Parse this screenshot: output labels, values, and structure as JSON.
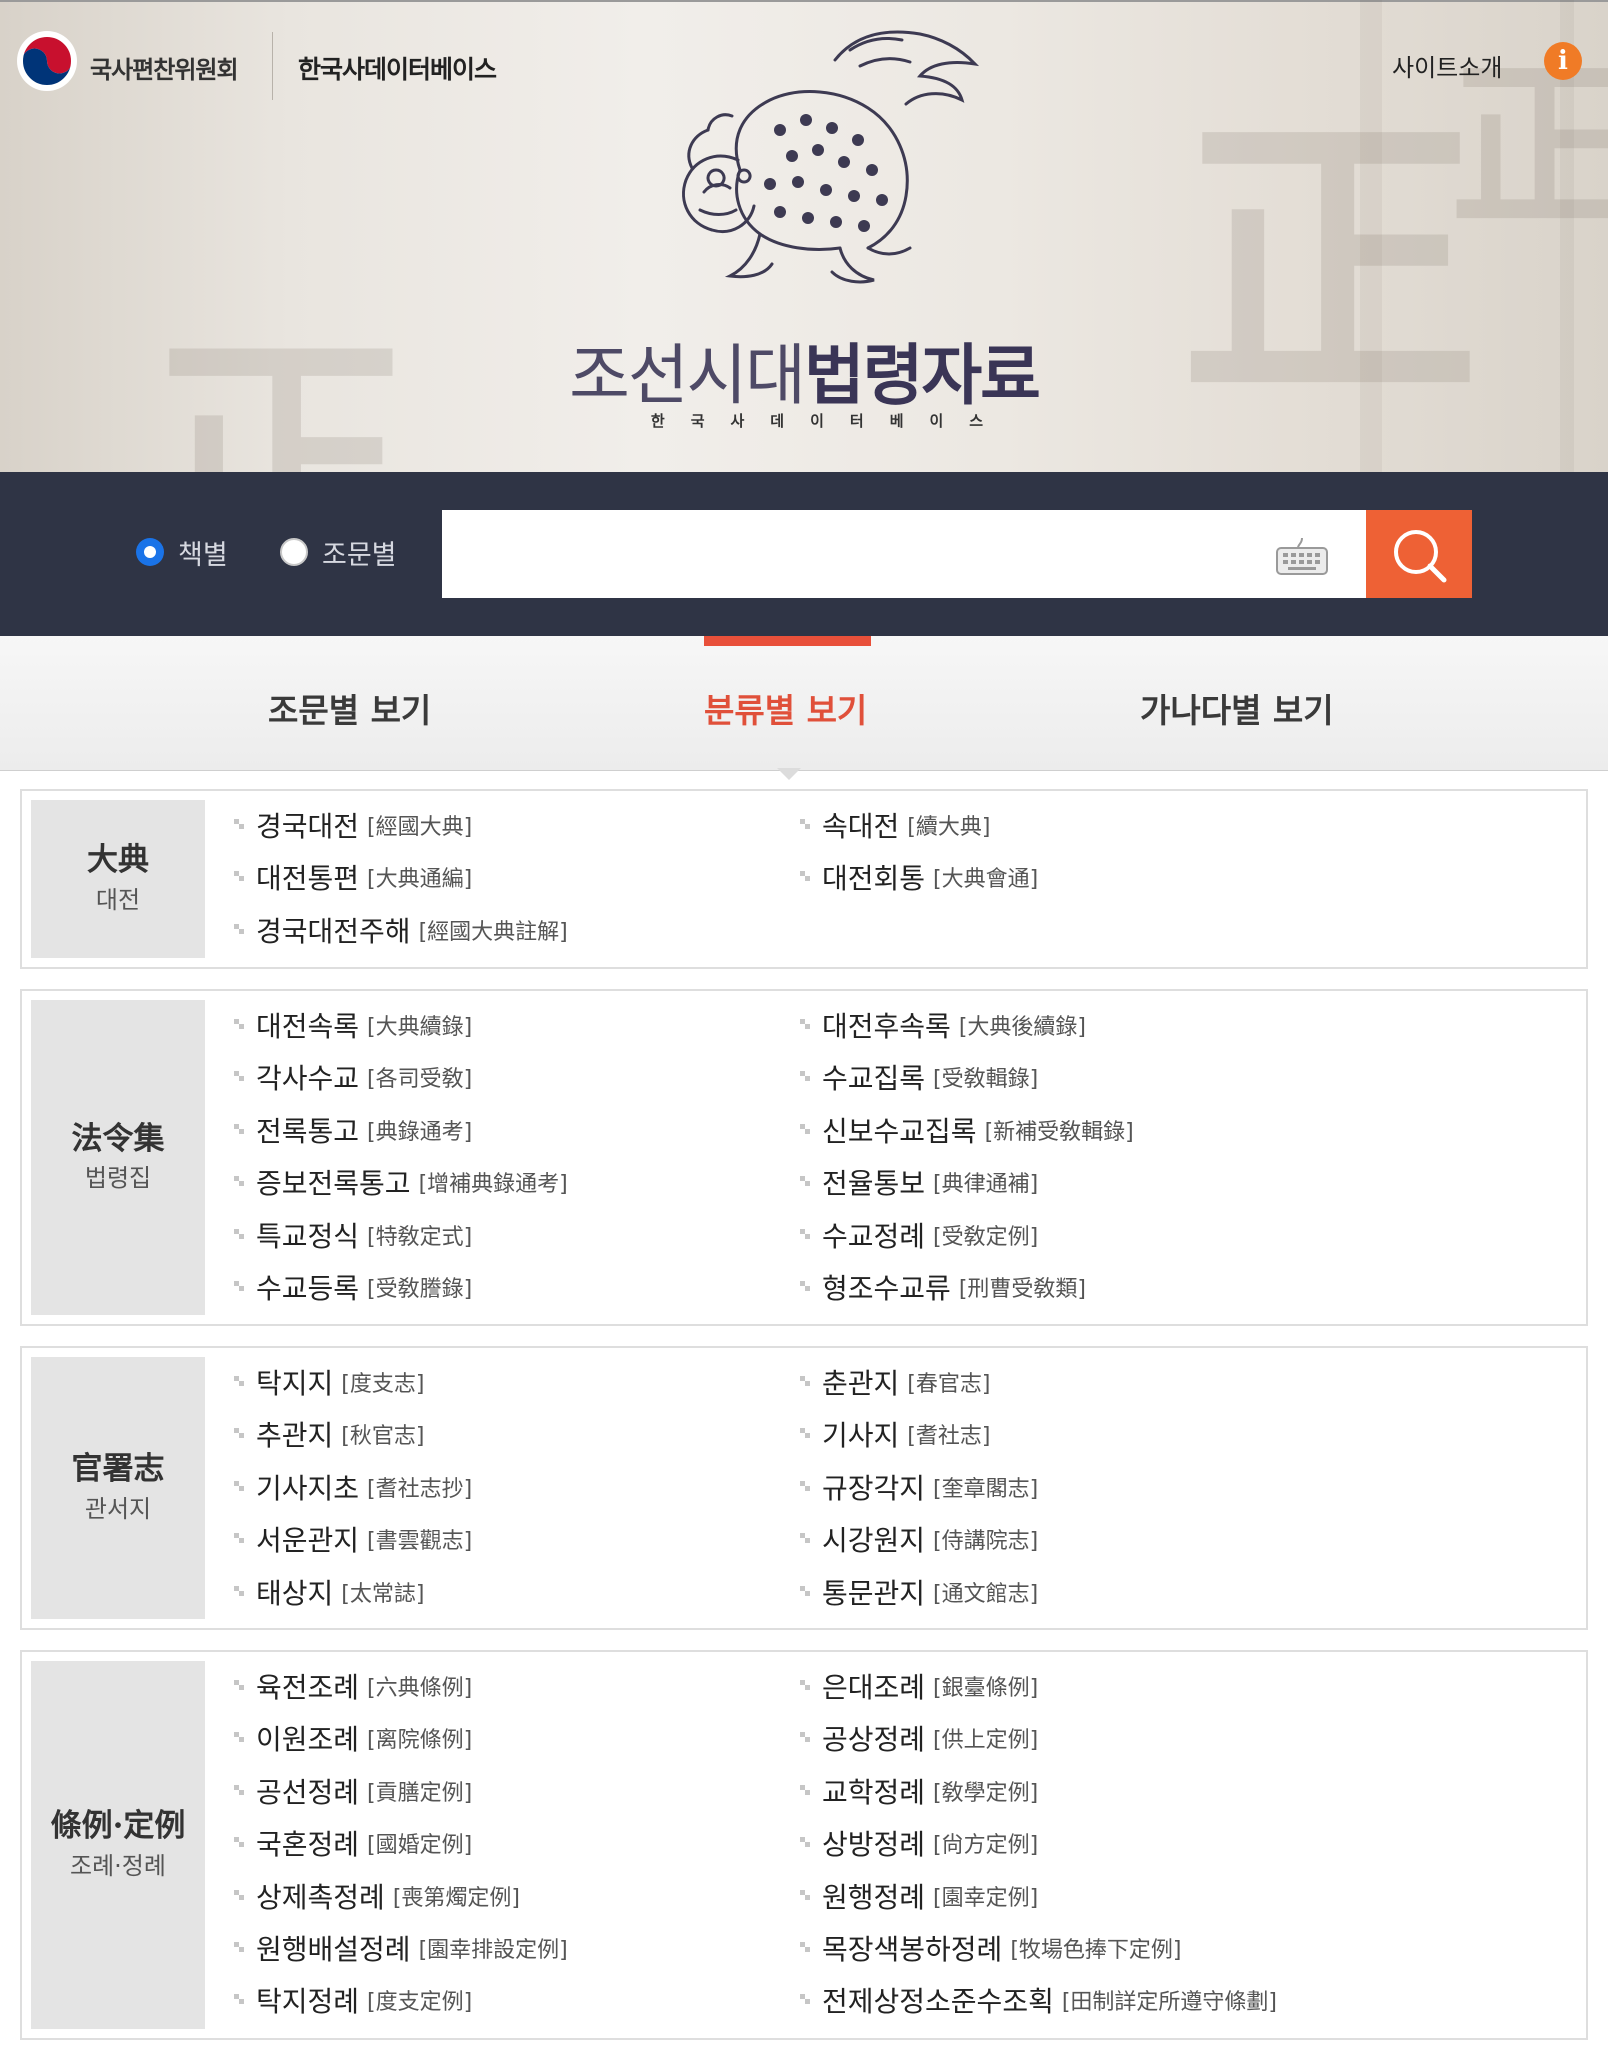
{
  "header": {
    "org_name": "국사편찬위원회",
    "db_name": "한국사데이터베이스",
    "site_intro": "사이트소개",
    "info_icon": "i",
    "title_light": "조선시대",
    "title_bold": "법령자료",
    "subtitle": "한국사데이터베이스"
  },
  "search": {
    "options": [
      {
        "label": "책별",
        "checked": true
      },
      {
        "label": "조문별",
        "checked": false
      }
    ],
    "placeholder": "",
    "accent_color": "#ee6135"
  },
  "tabs": [
    {
      "label": "조문별 보기",
      "active": false
    },
    {
      "label": "분류별 보기",
      "active": true
    },
    {
      "label": "가나다별 보기",
      "active": false
    }
  ],
  "sections": [
    {
      "hanja": "大典",
      "hangul": "대전",
      "items": [
        {
          "name": "경국대전",
          "hanja": "[經國大典]"
        },
        {
          "name": "속대전",
          "hanja": "[續大典]"
        },
        {
          "name": "대전통편",
          "hanja": "[大典通編]"
        },
        {
          "name": "대전회통",
          "hanja": "[大典會通]"
        },
        {
          "name": "경국대전주해",
          "hanja": "[經國大典註解]"
        }
      ]
    },
    {
      "hanja": "法令集",
      "hangul": "법령집",
      "items": [
        {
          "name": "대전속록",
          "hanja": "[大典續錄]"
        },
        {
          "name": "대전후속록",
          "hanja": "[大典後續錄]"
        },
        {
          "name": "각사수교",
          "hanja": "[各司受敎]"
        },
        {
          "name": "수교집록",
          "hanja": "[受敎輯錄]"
        },
        {
          "name": "전록통고",
          "hanja": "[典錄通考]"
        },
        {
          "name": "신보수교집록",
          "hanja": "[新補受敎輯錄]"
        },
        {
          "name": "증보전록통고",
          "hanja": "[增補典錄通考]"
        },
        {
          "name": "전율통보",
          "hanja": "[典律通補]"
        },
        {
          "name": "특교정식",
          "hanja": "[特敎定式]"
        },
        {
          "name": "수교정례",
          "hanja": "[受敎定例]"
        },
        {
          "name": "수교등록",
          "hanja": "[受敎謄錄]"
        },
        {
          "name": "형조수교류",
          "hanja": "[刑曹受敎類]"
        }
      ]
    },
    {
      "hanja": "官署志",
      "hangul": "관서지",
      "items": [
        {
          "name": "탁지지",
          "hanja": "[度支志]"
        },
        {
          "name": "춘관지",
          "hanja": "[春官志]"
        },
        {
          "name": "추관지",
          "hanja": "[秋官志]"
        },
        {
          "name": "기사지",
          "hanja": "[耆社志]"
        },
        {
          "name": "기사지초",
          "hanja": "[耆社志抄]"
        },
        {
          "name": "규장각지",
          "hanja": "[奎章閣志]"
        },
        {
          "name": "서운관지",
          "hanja": "[書雲觀志]"
        },
        {
          "name": "시강원지",
          "hanja": "[侍講院志]"
        },
        {
          "name": "태상지",
          "hanja": "[太常誌]"
        },
        {
          "name": "통문관지",
          "hanja": "[通文館志]"
        }
      ]
    },
    {
      "hanja": "條例·定例",
      "hangul": "조례·정례",
      "items": [
        {
          "name": "육전조례",
          "hanja": "[六典條例]"
        },
        {
          "name": "은대조례",
          "hanja": "[銀臺條例]"
        },
        {
          "name": "이원조례",
          "hanja": "[离院條例]"
        },
        {
          "name": "공상정례",
          "hanja": "[供上定例]"
        },
        {
          "name": "공선정례",
          "hanja": "[貢膳定例]"
        },
        {
          "name": "교학정례",
          "hanja": "[敎學定例]"
        },
        {
          "name": "국혼정례",
          "hanja": "[國婚定例]"
        },
        {
          "name": "상방정례",
          "hanja": "[尙方定例]"
        },
        {
          "name": "상제촉정례",
          "hanja": "[喪第燭定例]"
        },
        {
          "name": "원행정례",
          "hanja": "[園幸定例]"
        },
        {
          "name": "원행배설정례",
          "hanja": "[園幸排設定例]"
        },
        {
          "name": "목장색봉하정례",
          "hanja": "[牧場色捧下定例]"
        },
        {
          "name": "탁지정례",
          "hanja": "[度支定例]"
        },
        {
          "name": "전제상정소준수조획",
          "hanja": "[田制詳定所遵守條劃]"
        }
      ]
    }
  ]
}
